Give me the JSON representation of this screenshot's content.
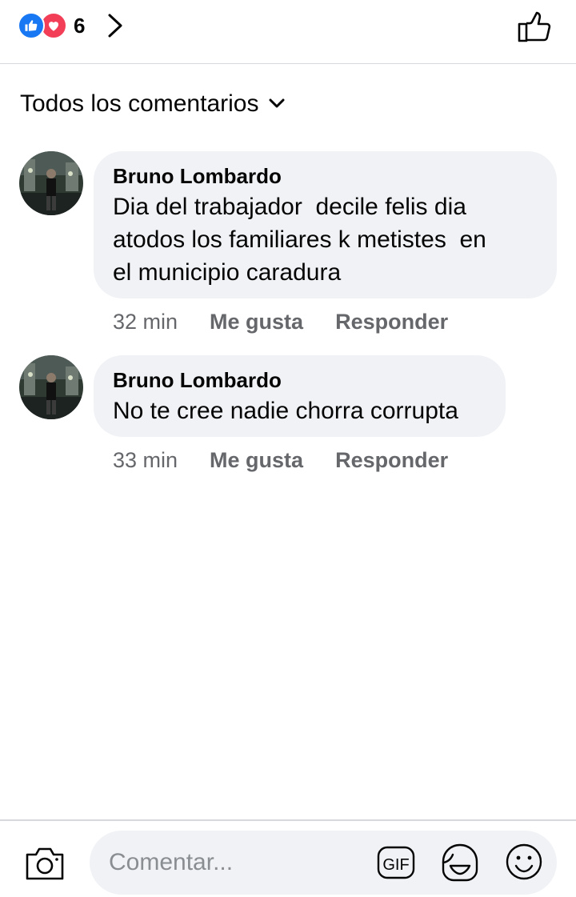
{
  "header": {
    "reaction_count": "6",
    "reactions": [
      "like-icon",
      "love-icon"
    ],
    "colors": {
      "like": "#1877f2",
      "love": "#f33e58"
    }
  },
  "filter": {
    "label": "Todos los comentarios"
  },
  "comments": [
    {
      "author": "Bruno Lombardo",
      "text": "Dia del trabajador  decile felis dia\natodos los familiares k metistes  en\nel municipio caradura",
      "time": "32 min",
      "like_label": "Me gusta",
      "reply_label": "Responder"
    },
    {
      "author": "Bruno Lombardo",
      "text": "No te cree nadie chorra corrupta",
      "time": "33 min",
      "like_label": "Me gusta",
      "reply_label": "Responder"
    }
  ],
  "composer": {
    "placeholder": "Comentar...",
    "gif_label": "GIF"
  },
  "colors": {
    "bubble": "#f0f2f5",
    "secondary_text": "#65676b",
    "divider": "#d6d8db"
  }
}
